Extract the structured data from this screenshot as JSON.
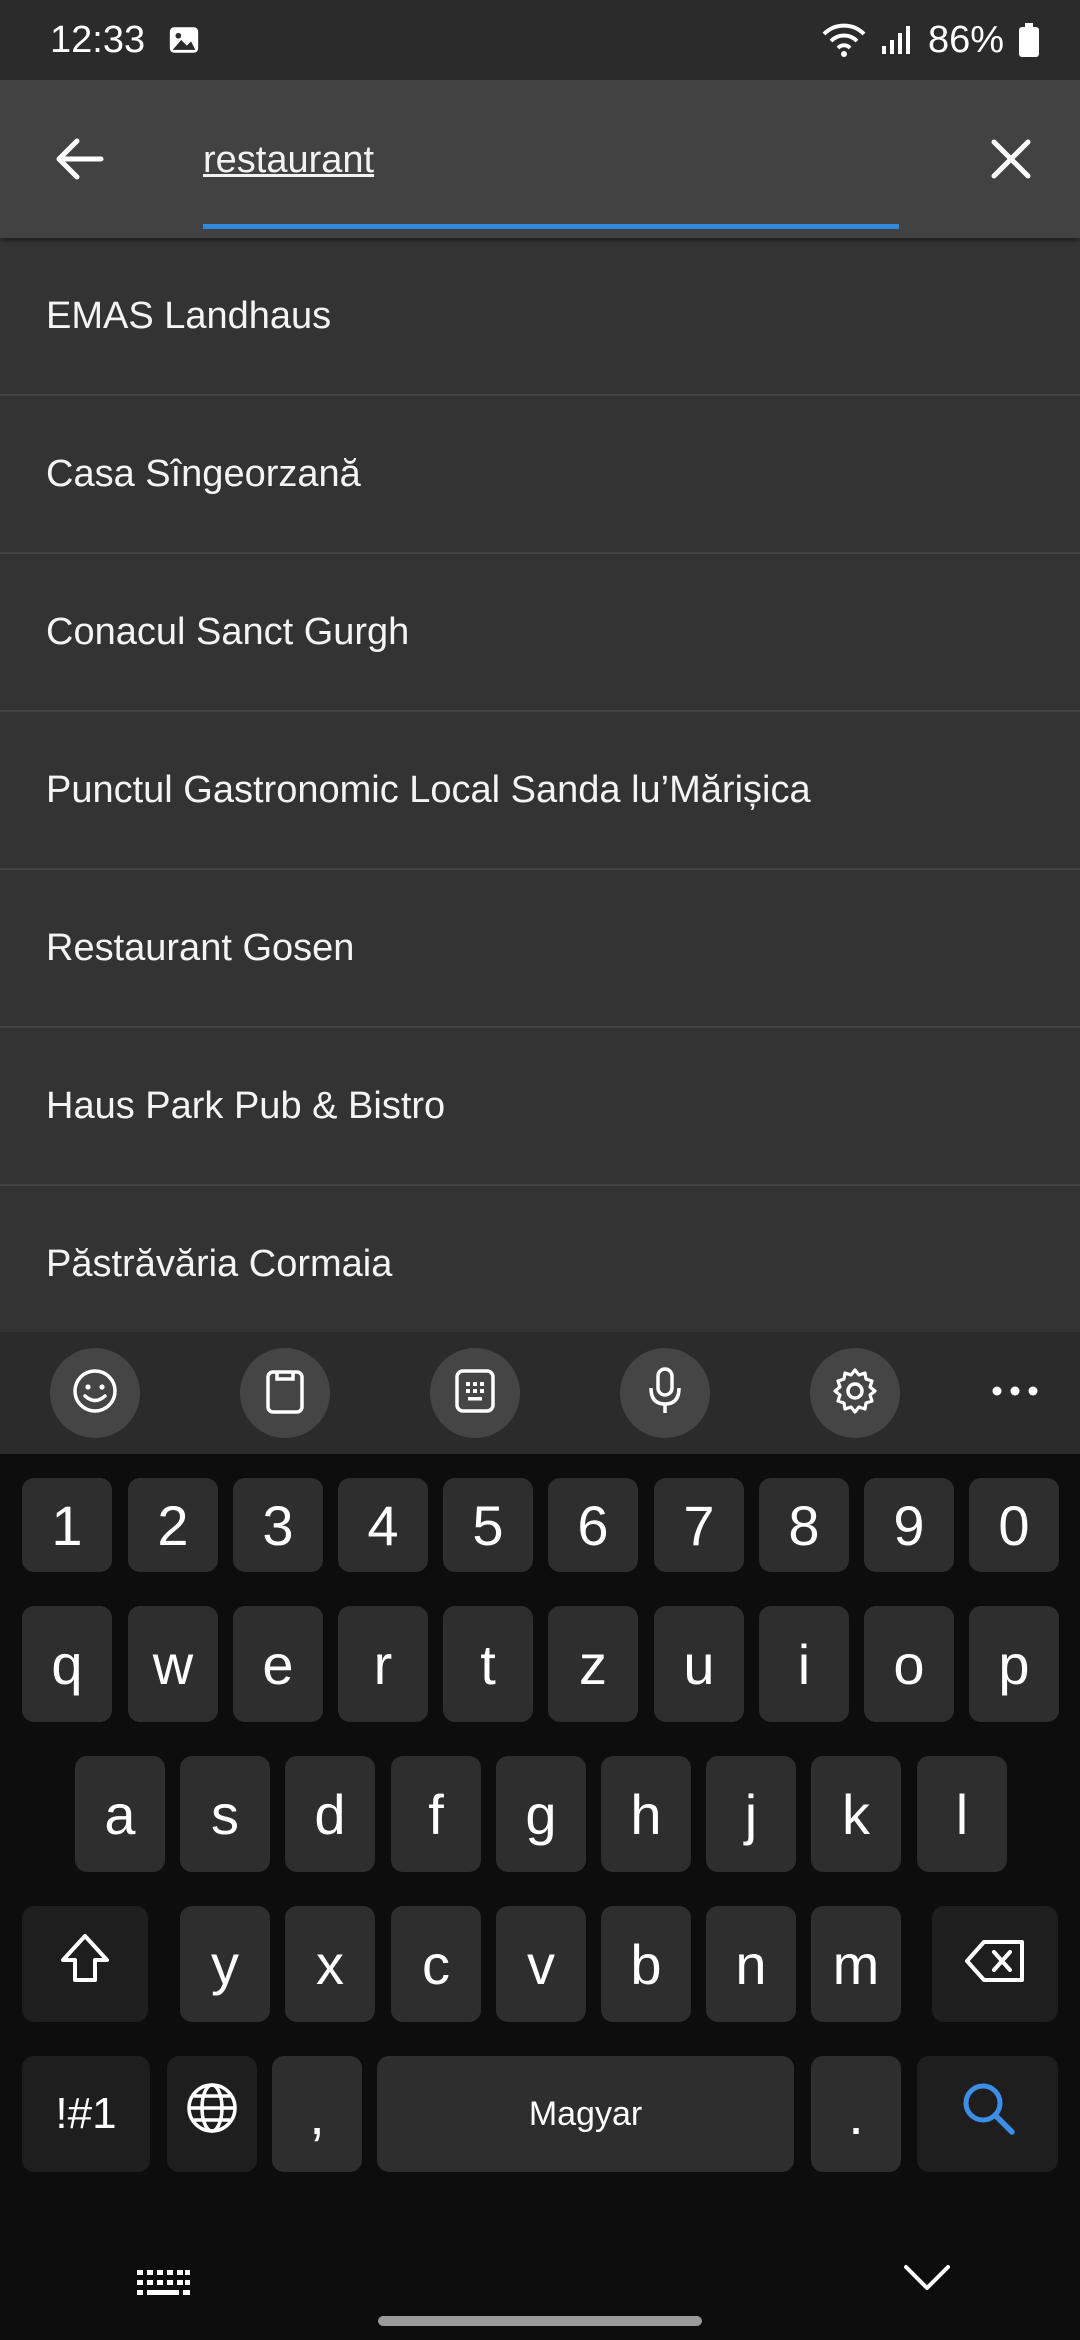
{
  "status_bar": {
    "time": "12:33",
    "battery": "86%",
    "icons": [
      "image-icon",
      "wifi-icon",
      "signal-icon",
      "battery-icon"
    ]
  },
  "search": {
    "query": "restaurant",
    "back_icon": "arrow-left-icon",
    "clear_icon": "close-icon",
    "accent": "#2f8ae0"
  },
  "results": [
    "EMAS Landhaus",
    "Casa Sîngeorzană",
    "Conacul Sanct Gurgh",
    "Punctul Gastronomic Local Sanda lu’Mărișica",
    "Restaurant Gosen",
    "Haus Park Pub & Bistro",
    "Păstrăvăria Cormaia"
  ],
  "keyboard": {
    "toolbar_icons": [
      "emoji-icon",
      "clipboard-icon",
      "keyboard-mode-icon",
      "microphone-icon",
      "settings-icon",
      "more-icon"
    ],
    "number_row": [
      "1",
      "2",
      "3",
      "4",
      "5",
      "6",
      "7",
      "8",
      "9",
      "0"
    ],
    "row1": [
      "q",
      "w",
      "e",
      "r",
      "t",
      "z",
      "u",
      "i",
      "o",
      "p"
    ],
    "row2": [
      "a",
      "s",
      "d",
      "f",
      "g",
      "h",
      "j",
      "k",
      "l"
    ],
    "row3": [
      "y",
      "x",
      "c",
      "v",
      "b",
      "n",
      "m"
    ],
    "symbols_label": "!#1",
    "comma": ",",
    "space_label": "Magyar",
    "period": ".",
    "shift_icon": "shift-icon",
    "backspace_icon": "backspace-icon",
    "globe_icon": "globe-icon",
    "search_icon": "search-icon",
    "search_key_color": "#3d8ee6"
  },
  "nav": {
    "keyboard_hide_icon": "keyboard-icon",
    "collapse_icon": "chevron-down-icon"
  }
}
